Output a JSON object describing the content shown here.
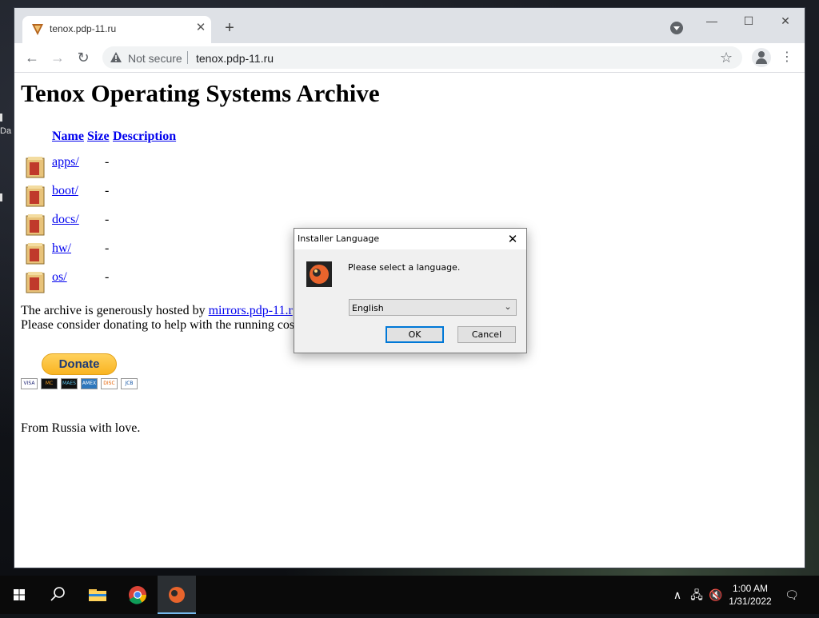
{
  "desktop": {
    "fragment_1": "Da"
  },
  "browser": {
    "tab_title": "tenox.pdp-11.ru",
    "not_secure": "Not secure",
    "url": "tenox.pdp-11.ru"
  },
  "page": {
    "title": "Tenox Operating Systems Archive",
    "headers": {
      "name": "Name",
      "size": "Size",
      "description": "Description"
    },
    "rows": [
      {
        "name": "apps/",
        "size": "-"
      },
      {
        "name": "boot/",
        "size": "-"
      },
      {
        "name": "docs/",
        "size": "-"
      },
      {
        "name": "hw/",
        "size": "-"
      },
      {
        "name": "os/",
        "size": "-"
      }
    ],
    "hosted_text": "The archive is generously hosted by ",
    "hosted_link": "mirrors.pdp-11.r",
    "donate_text": "Please consider donating to help with the running cos",
    "donate_button": "Donate",
    "cards": [
      "VISA",
      "MC",
      "MAES",
      "AMEX",
      "DISC",
      "JCB"
    ],
    "footer": "From Russia with love."
  },
  "dialog": {
    "title": "Installer Language",
    "message": "Please select a language.",
    "language": "English",
    "ok": "OK",
    "cancel": "Cancel"
  },
  "taskbar": {
    "time": "1:00 AM",
    "date": "1/31/2022"
  },
  "colors": {
    "link": "#0000ee",
    "accent": "#0078d7",
    "tabstrip": "#dee1e6"
  }
}
